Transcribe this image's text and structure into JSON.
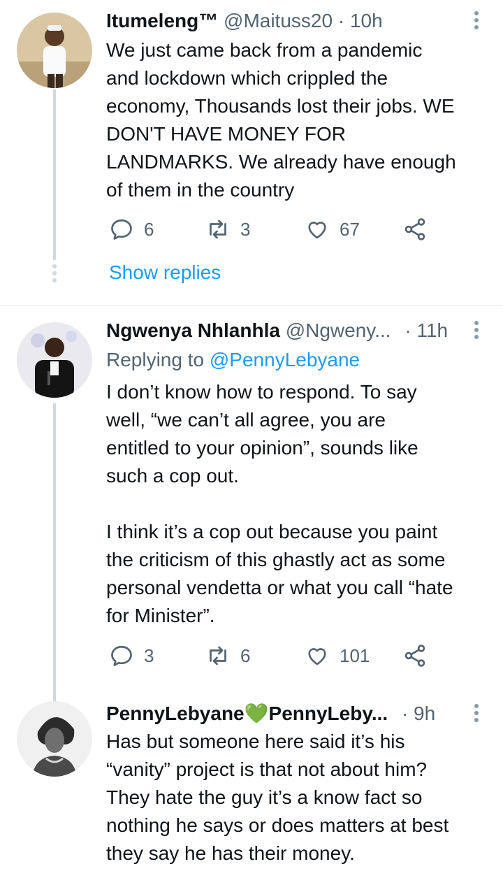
{
  "tweets": [
    {
      "name": "Itumeleng™",
      "handle": "@Maituss20",
      "dot": "·",
      "time": "10h",
      "lines": [
        "We just came back from a pandemic",
        "and lockdown which crippled the",
        "economy, Thousands lost their jobs. WE",
        "DON'T HAVE MONEY FOR",
        "LANDMARKS. We already have enough",
        "of them in the country"
      ],
      "replies": "6",
      "retweets": "3",
      "likes": "67",
      "show_replies": "Show replies"
    },
    {
      "name": "Ngwenya Nhlanhla",
      "handle": "@Ngweny...",
      "dot": "·",
      "time": "11h",
      "replying_prefix": "Replying to",
      "replying_mention": "@PennyLebyane",
      "lines": [
        "I don’t know how to respond. To say",
        "well, “we can’t all agree, you are",
        "entitled to your opinion”, sounds like",
        "such a cop out.",
        "",
        "I think it’s a cop out because you paint",
        "the criticism of this ghastly act as some",
        "personal vendetta or what you call “hate",
        "for Minister”."
      ],
      "replies": "3",
      "retweets": "6",
      "likes": "101"
    },
    {
      "name": "PennyLebyane",
      "name_emoji": "💚",
      "display_name2": "PennyLeby...",
      "dot": "·",
      "time": "9h",
      "lines": [
        "Has but someone here said it’s his",
        "“vanity” project is that not about him?",
        "They hate the guy it’s a know fact so",
        "nothing he says or does matters at best",
        "they say he has their money."
      ]
    }
  ],
  "colors": {
    "accent": "#1d9bf0",
    "secondary_text": "#536471",
    "thread_line": "#cfd9de",
    "emoji_heart": "#7bc043"
  }
}
